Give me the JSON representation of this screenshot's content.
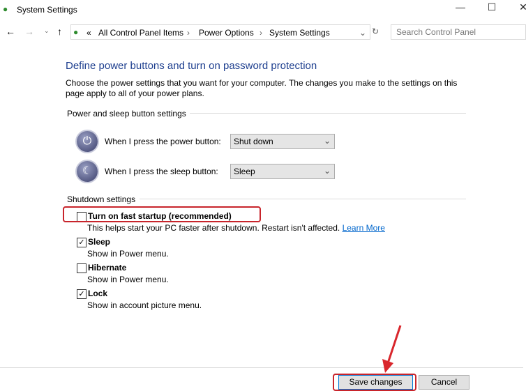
{
  "window": {
    "title": "System Settings"
  },
  "nav": {
    "breadcrumbs": [
      "All Control Panel Items",
      "Power Options",
      "System Settings"
    ],
    "search_placeholder": "Search Control Panel"
  },
  "main": {
    "heading": "Define power buttons and turn on password protection",
    "description": "Choose the power settings that you want for your computer. The changes you make to the settings on this page apply to all of your power plans.",
    "power_section": "Power and sleep button settings",
    "power_label": "When I press the power button:",
    "power_value": "Shut down",
    "sleep_label": "When I press the sleep button:",
    "sleep_value": "Sleep",
    "shutdown_section": "Shutdown settings",
    "options": [
      {
        "label": "Turn on fast startup (recommended)",
        "desc": "This helps start your PC faster after shutdown. Restart isn't affected.",
        "checked": false
      },
      {
        "label": "Sleep",
        "desc": "Show in Power menu.",
        "checked": true
      },
      {
        "label": "Hibernate",
        "desc": "Show in Power menu.",
        "checked": false
      },
      {
        "label": "Lock",
        "desc": "Show in account picture menu.",
        "checked": true
      }
    ],
    "learn_more": "Learn More"
  },
  "footer": {
    "save": "Save changes",
    "cancel": "Cancel"
  },
  "colors": {
    "highlight": "#c8242b",
    "heading": "#1e3f8f",
    "link": "#0066cc"
  }
}
